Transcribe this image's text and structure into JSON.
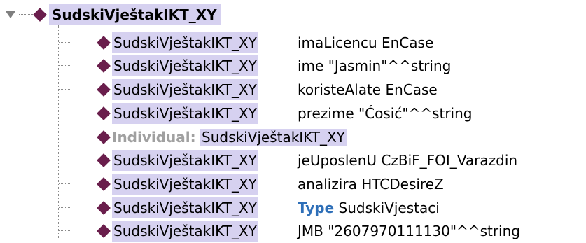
{
  "root": {
    "label": "SudskiVještakIKT_XY"
  },
  "rows": [
    {
      "subject": "SudskiVještakIKT_XY",
      "rest": "imaLicencu EnCase"
    },
    {
      "subject": "SudskiVještakIKT_XY",
      "rest": "ime \"Jasmin\"^^string"
    },
    {
      "subject": "SudskiVještakIKT_XY",
      "rest": "koristeAlate EnCase"
    },
    {
      "subject": "SudskiVještakIKT_XY",
      "rest": "prezime \"Ćosić\"^^string"
    },
    {
      "keyword": "Individual:",
      "name": "SudskiVještakIKT_XY"
    },
    {
      "subject": "SudskiVještakIKT_XY",
      "rest": "jeUposlenU CzBiF_FOI_Varazdin"
    },
    {
      "subject": "SudskiVještakIKT_XY",
      "rest": "analizira HTCDesireZ"
    },
    {
      "subject": "SudskiVještakIKT_XY",
      "type_keyword": "Type",
      "rest": "SudskiVjestaci"
    },
    {
      "subject": "SudskiVještakIKT_XY",
      "rest": "JMB \"2607970111130\"^^string"
    }
  ],
  "colors": {
    "highlight": "#d6d1f0",
    "diamond": "#6a1e4c",
    "type_keyword": "#2e6fb8",
    "individual_keyword": "#a0a0a0"
  }
}
